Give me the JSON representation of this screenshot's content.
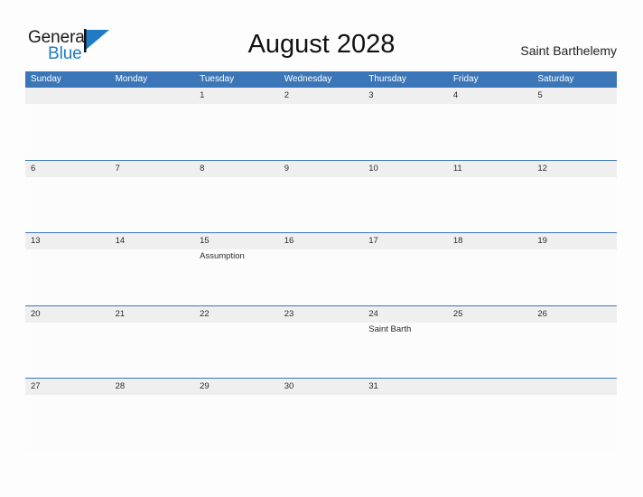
{
  "brand": {
    "name_part1": "General",
    "name_part2": "Blue",
    "flag_color": "#1f7cc4"
  },
  "header": {
    "title": "August 2028",
    "location": "Saint Barthelemy"
  },
  "theme": {
    "header_blue": "#3b77b8",
    "strip_gray": "#efefef",
    "cell_white": "#fcfcfc",
    "text_dark": "#2b2b2b"
  },
  "calendar": {
    "weekdays": [
      "Sunday",
      "Monday",
      "Tuesday",
      "Wednesday",
      "Thursday",
      "Friday",
      "Saturday"
    ],
    "weeks": [
      [
        {
          "day": "",
          "event": ""
        },
        {
          "day": "",
          "event": ""
        },
        {
          "day": "1",
          "event": ""
        },
        {
          "day": "2",
          "event": ""
        },
        {
          "day": "3",
          "event": ""
        },
        {
          "day": "4",
          "event": ""
        },
        {
          "day": "5",
          "event": ""
        }
      ],
      [
        {
          "day": "6",
          "event": ""
        },
        {
          "day": "7",
          "event": ""
        },
        {
          "day": "8",
          "event": ""
        },
        {
          "day": "9",
          "event": ""
        },
        {
          "day": "10",
          "event": ""
        },
        {
          "day": "11",
          "event": ""
        },
        {
          "day": "12",
          "event": ""
        }
      ],
      [
        {
          "day": "13",
          "event": ""
        },
        {
          "day": "14",
          "event": ""
        },
        {
          "day": "15",
          "event": "Assumption"
        },
        {
          "day": "16",
          "event": ""
        },
        {
          "day": "17",
          "event": ""
        },
        {
          "day": "18",
          "event": ""
        },
        {
          "day": "19",
          "event": ""
        }
      ],
      [
        {
          "day": "20",
          "event": ""
        },
        {
          "day": "21",
          "event": ""
        },
        {
          "day": "22",
          "event": ""
        },
        {
          "day": "23",
          "event": ""
        },
        {
          "day": "24",
          "event": "Saint Barth"
        },
        {
          "day": "25",
          "event": ""
        },
        {
          "day": "26",
          "event": ""
        }
      ],
      [
        {
          "day": "27",
          "event": ""
        },
        {
          "day": "28",
          "event": ""
        },
        {
          "day": "29",
          "event": ""
        },
        {
          "day": "30",
          "event": ""
        },
        {
          "day": "31",
          "event": ""
        },
        {
          "day": "",
          "event": ""
        },
        {
          "day": "",
          "event": ""
        }
      ]
    ]
  }
}
